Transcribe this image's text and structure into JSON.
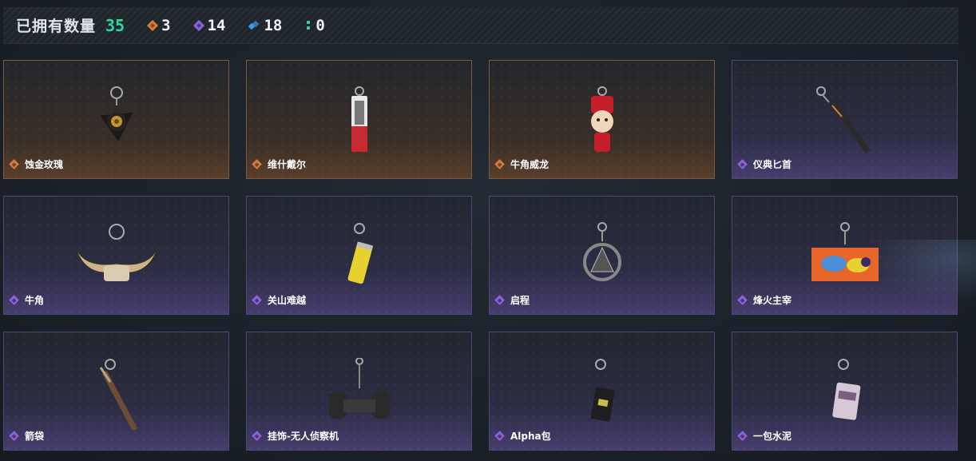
{
  "header": {
    "title": "已拥有数量",
    "total": "35",
    "stats": [
      {
        "rarity": "orange",
        "value": "3",
        "color": "#d47c3e"
      },
      {
        "rarity": "purple",
        "value": "14",
        "color": "#8a63d8"
      },
      {
        "rarity": "blue",
        "value": "18",
        "color": "#3d9be8"
      },
      {
        "rarity": "green",
        "value": "0",
        "color": "#2fd89a"
      }
    ]
  },
  "items": [
    {
      "name": "蚀金玫瑰",
      "rarity": "orange",
      "icon": "rose-pendant-icon"
    },
    {
      "name": "维什戴尔",
      "rarity": "orange",
      "icon": "figure-box-icon"
    },
    {
      "name": "牛角威龙",
      "rarity": "orange",
      "icon": "chibi-doll-icon"
    },
    {
      "name": "仪典匕首",
      "rarity": "purple",
      "icon": "dagger-icon"
    },
    {
      "name": "牛角",
      "rarity": "purple",
      "icon": "bull-horns-icon"
    },
    {
      "name": "关山难越",
      "rarity": "purple",
      "icon": "can-icon"
    },
    {
      "name": "启程",
      "rarity": "purple",
      "icon": "medallion-icon"
    },
    {
      "name": "烽火主宰",
      "rarity": "purple",
      "icon": "container-icon"
    },
    {
      "name": "箭袋",
      "rarity": "purple",
      "icon": "quiver-icon"
    },
    {
      "name": "挂饰-无人侦察机",
      "rarity": "purple",
      "icon": "drone-icon"
    },
    {
      "name": "Alpha包",
      "rarity": "purple",
      "icon": "pouch-icon"
    },
    {
      "name": "一包水泥",
      "rarity": "purple",
      "icon": "cement-bag-icon"
    }
  ]
}
